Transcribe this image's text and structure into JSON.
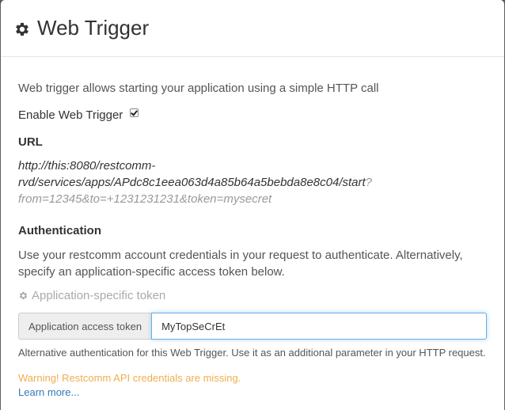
{
  "modal": {
    "title": "Web Trigger",
    "header_icon": "gear-icon",
    "description": "Web trigger allows starting your application using a simple HTTP call",
    "enable": {
      "label": "Enable Web Trigger",
      "checked": true
    },
    "url_section": {
      "heading": "URL",
      "url_line1": "http://this:8080/restcomm-",
      "url_line2": "rvd/services/apps/APdc8c1eea063d4a85b64a5bebda8e8c04/start",
      "url_query_start": "?",
      "url_query_rest": "from=12345&to=+1231231231&token=mysecret"
    },
    "auth_section": {
      "heading": "Authentication",
      "description": "Use your restcomm account credentials in your request to authenticate. Alternatively, specify an application-specific access token below.",
      "token_toggle_label": "Application-specific token",
      "token_toggle_icon": "gear-icon",
      "token_addon_label": "Application access token",
      "token_value": "MyTopSeCrEt",
      "help_text": "Alternative authentication for this Web Trigger. Use it as an additional parameter in your HTTP request.",
      "warning": "Warning! Restcomm API credentials are missing.",
      "learn_more": "Learn more..."
    }
  },
  "colors": {
    "warning": "#f0ad4e",
    "link": "#337ab7",
    "input_focus": "#66afe9",
    "muted": "#999999"
  }
}
